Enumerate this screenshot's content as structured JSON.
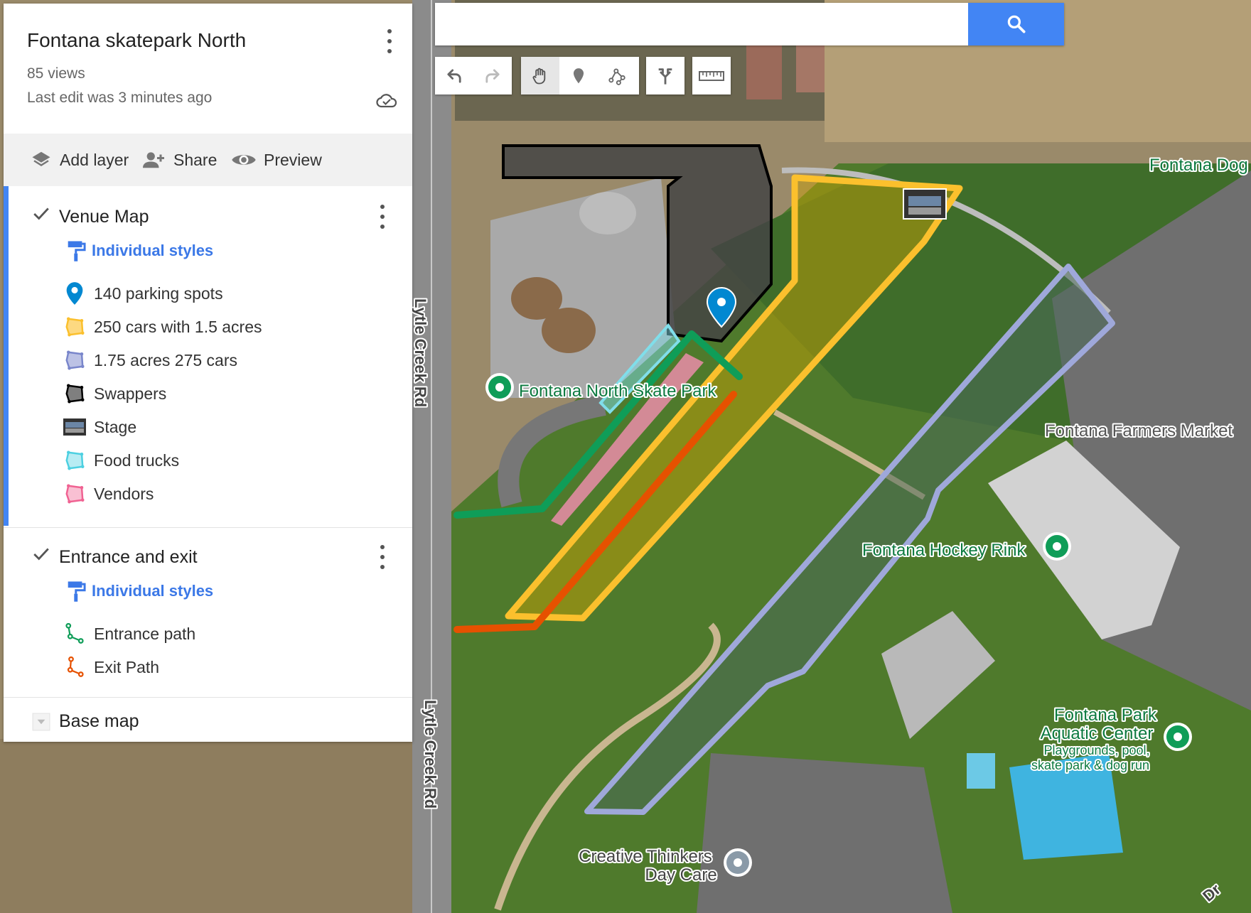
{
  "map": {
    "title": "Fontana skatepark North",
    "views": "85 views",
    "last_edit": "Last edit was 3 minutes ago"
  },
  "actions": {
    "add_layer": "Add layer",
    "share": "Share",
    "preview": "Preview"
  },
  "layers": [
    {
      "name": "Venue Map",
      "checked": true,
      "styles_label": "Individual styles",
      "items": [
        {
          "label": "140 parking spots",
          "icon": "blue-pin-icon",
          "color": "#0288d1"
        },
        {
          "label": "250 cars with 1.5 acres",
          "icon": "yellow-polygon-icon",
          "color": "#fbc02d"
        },
        {
          "label": "1.75 acres 275 cars",
          "icon": "purple-polygon-icon",
          "color": "#7986cb"
        },
        {
          "label": "Swappers",
          "icon": "black-polygon-icon",
          "color": "#000000"
        },
        {
          "label": "Stage",
          "icon": "stage-photo-icon",
          "color": "#555555"
        },
        {
          "label": "Food trucks",
          "icon": "cyan-polygon-icon",
          "color": "#4dd0e1"
        },
        {
          "label": "Vendors",
          "icon": "pink-polygon-icon",
          "color": "#f06292"
        }
      ]
    },
    {
      "name": "Entrance and exit",
      "checked": true,
      "styles_label": "Individual styles",
      "items": [
        {
          "label": "Entrance path",
          "icon": "green-line-icon",
          "color": "#0f9d58"
        },
        {
          "label": "Exit Path",
          "icon": "orange-line-icon",
          "color": "#e65100"
        }
      ]
    }
  ],
  "base_map": "Base map",
  "search": {
    "placeholder": ""
  },
  "map_labels": {
    "fontana_north_skate_park": "Fontana North Skate Park",
    "fontana_dog": "Fontana Dog",
    "fontana_farmers_market": "Fontana Farmers Market",
    "fontana_hockey_rink": "Fontana Hockey Rink",
    "aquatic_center_1": "Fontana Park",
    "aquatic_center_2": "Aquatic Center",
    "aquatic_sub_1": "Playgrounds, pool,",
    "aquatic_sub_2": "skate park & dog run",
    "daycare_1": "Creative Thinkers",
    "daycare_2": "Day Care",
    "road_1": "Lytle Creek Rd",
    "road_2": "Lytle Creek Rd",
    "road_3": "Dr"
  },
  "colors": {
    "accent": "#4285f4",
    "yellow_outline": "#fbc02d",
    "purple_outline": "#9fa8da",
    "entrance": "#0f9d58",
    "exit": "#e65100",
    "food_trucks": "#80deea",
    "vendors": "#f48fb1",
    "place_pin": "#0f9d58"
  }
}
